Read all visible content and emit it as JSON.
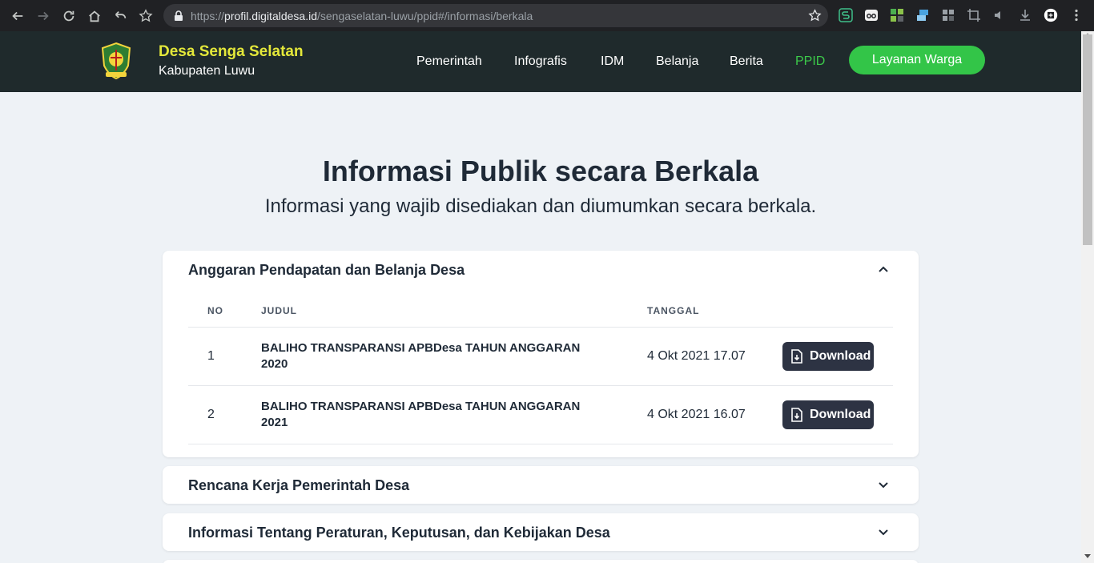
{
  "browser": {
    "url_scheme": "https://",
    "url_host": "profil.digitaldesa.id",
    "url_path": "/sengaselatan-luwu/ppid#/informasi/berkala"
  },
  "site": {
    "brand_title": "Desa Senga Selatan",
    "brand_subtitle": "Kabupaten Luwu",
    "menu": [
      "Pemerintah",
      "Infografis",
      "IDM",
      "Belanja",
      "Berita",
      "PPID"
    ],
    "active_menu": "PPID",
    "cta_label": "Layanan Warga"
  },
  "main": {
    "title": "Informasi Publik secara Berkala",
    "subtitle": "Informasi yang wajib disediakan dan diumumkan secara berkala.",
    "sections": [
      {
        "title": "Anggaran Pendapatan dan Belanja Desa",
        "expanded": true,
        "columns": [
          "NO",
          "JUDUL",
          "TANGGAL"
        ],
        "rows": [
          {
            "no": "1",
            "title": "BALIHO TRANSPARANSI APBDesa TAHUN ANGGARAN 2020",
            "date": "4 Okt 2021 17.07",
            "action": "Download"
          },
          {
            "no": "2",
            "title": "BALIHO TRANSPARANSI APBDesa TAHUN ANGGARAN 2021",
            "date": "4 Okt 2021 16.07",
            "action": "Download"
          }
        ]
      },
      {
        "title": "Rencana Kerja Pemerintah Desa",
        "expanded": false
      },
      {
        "title": "Informasi Tentang Peraturan, Keputusan, dan Kebijakan Desa",
        "expanded": false
      }
    ]
  },
  "colors": {
    "header_bg": "#1f2a2c",
    "brand_yellow": "#e4e83a",
    "accent_green": "#33c548",
    "button_dark": "#2d3343",
    "page_bg": "#eef2f6"
  }
}
